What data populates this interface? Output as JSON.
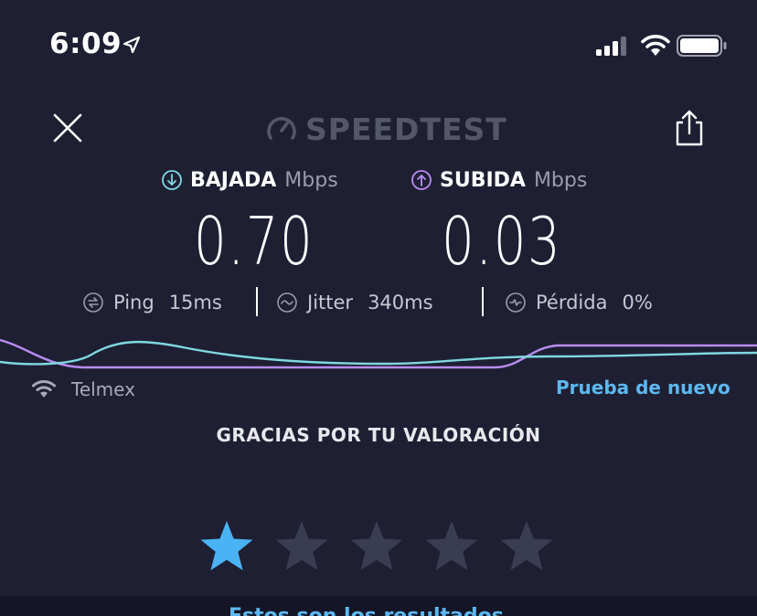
{
  "status_bar": {
    "time": "6:09",
    "location_icon": "location-arrow-icon",
    "signal_icon": "cellular-signal-icon",
    "wifi_icon": "wifi-icon",
    "battery_icon": "battery-icon"
  },
  "header": {
    "close_icon": "close-icon",
    "logo_text": "SPEEDTEST",
    "logo_icon": "gauge-icon",
    "share_icon": "share-icon"
  },
  "results": {
    "download": {
      "label": "BAJADA",
      "unit": "Mbps",
      "value": "0.70",
      "icon": "download-arrow-icon",
      "color": "#7fd8e0"
    },
    "upload": {
      "label": "SUBIDA",
      "unit": "Mbps",
      "value": "0.03",
      "icon": "upload-arrow-icon",
      "color": "#b98cf0"
    }
  },
  "metrics": {
    "ping": {
      "label": "Ping",
      "value": "15ms",
      "icon": "ping-icon"
    },
    "jitter": {
      "label": "Jitter",
      "value": "340ms",
      "icon": "jitter-icon"
    },
    "loss": {
      "label": "Pérdida",
      "value": "0%",
      "icon": "packet-loss-icon"
    }
  },
  "provider": {
    "name": "Telmex",
    "icon": "wifi-icon"
  },
  "actions": {
    "retry_label": "Prueba de nuevo"
  },
  "rating": {
    "title": "GRACIAS POR TU VALORACIÓN",
    "selected": 1,
    "max": 5,
    "active_color": "#4ab3f4",
    "inactive_color": "#3a3c52"
  },
  "bottom": {
    "partial_text": "Estos son los resultados"
  },
  "colors": {
    "background": "#1e1f33",
    "accent": "#5cb8f0"
  }
}
